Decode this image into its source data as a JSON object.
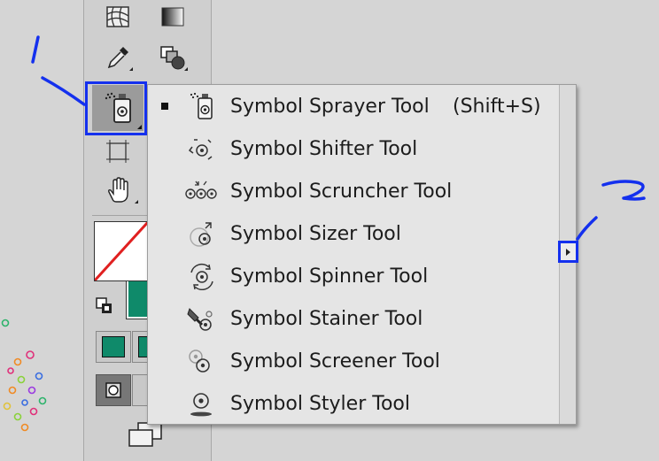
{
  "menu": {
    "items": [
      {
        "label": "Symbol Sprayer Tool",
        "shortcut": "(Shift+S)",
        "icon": "symbol-sprayer-icon",
        "selected": true
      },
      {
        "label": "Symbol Shifter Tool",
        "icon": "symbol-shifter-icon"
      },
      {
        "label": "Symbol Scruncher Tool",
        "icon": "symbol-scruncher-icon"
      },
      {
        "label": "Symbol Sizer Tool",
        "icon": "symbol-sizer-icon"
      },
      {
        "label": "Symbol Spinner Tool",
        "icon": "symbol-spinner-icon"
      },
      {
        "label": "Symbol Stainer Tool",
        "icon": "symbol-stainer-icon"
      },
      {
        "label": "Symbol Screener Tool",
        "icon": "symbol-screener-icon"
      },
      {
        "label": "Symbol Styler Tool",
        "icon": "symbol-styler-icon"
      }
    ],
    "tearoff_icon": "tearoff-arrow-icon"
  },
  "annotations": {
    "first": "1",
    "second": "2",
    "color": "#1430ee"
  },
  "colors": {
    "fill_swatch": "#0f8a6a",
    "stroke_line": "#e02020",
    "annotation": "#1430ee"
  },
  "toolbar": {
    "icons": [
      "mesh-icon",
      "gradient-icon",
      "eyedropper-icon",
      "blend-icon",
      "symbol-sprayer-icon",
      "artboard-icon",
      "hand-icon",
      "swap-fill-stroke-icon",
      "default-fill-stroke-icon",
      "color-mode-icon",
      "draw-mode-icon",
      "screen-mode-icon"
    ]
  }
}
